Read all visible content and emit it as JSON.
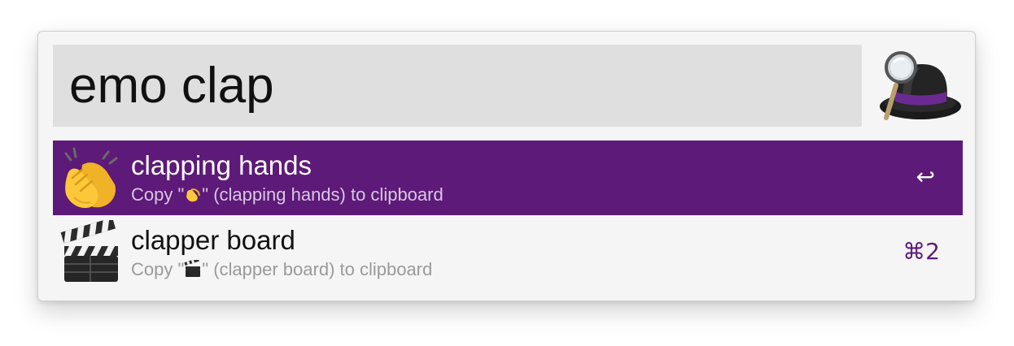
{
  "search": {
    "query": "emo clap"
  },
  "app": {
    "logo_icon": "alfred-hat-icon"
  },
  "results": [
    {
      "title": "clapping hands",
      "subtitle_prefix": "Copy \"",
      "subtitle_suffix": "\" (clapping hands) to clipboard",
      "icon": "clapping-hands-icon",
      "shortcut": "↩",
      "selected": true
    },
    {
      "title": "clapper board",
      "subtitle_prefix": "Copy \"",
      "subtitle_suffix": "\" (clapper board) to clipboard",
      "icon": "clapper-board-icon",
      "shortcut": "⌘2",
      "selected": false
    }
  ],
  "colors": {
    "selection": "#5d1a78",
    "panel_background": "#f5f5f5",
    "search_field": "#dfdfdf",
    "shortcut_text": "#5d1a78"
  }
}
